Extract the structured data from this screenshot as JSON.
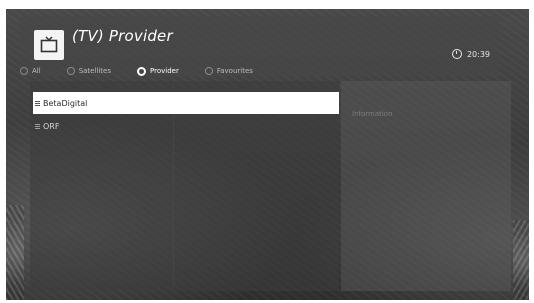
{
  "header": {
    "title": "(TV) Provider",
    "icon": "tv-icon",
    "time": "20:39"
  },
  "tabs": [
    {
      "label": "All",
      "active": false
    },
    {
      "label": "Satellites",
      "active": false
    },
    {
      "label": "Provider",
      "active": true
    },
    {
      "label": "Favourites",
      "active": false
    }
  ],
  "list": {
    "items": [
      {
        "label": "BetaDigital",
        "selected": true
      },
      {
        "label": "ORF",
        "selected": false
      }
    ]
  },
  "right_panel": {
    "label": "Information"
  },
  "colors": {
    "selected_background": "#ffffff",
    "panel_background": "#3f3f3f",
    "text": "#d6d6d6"
  }
}
